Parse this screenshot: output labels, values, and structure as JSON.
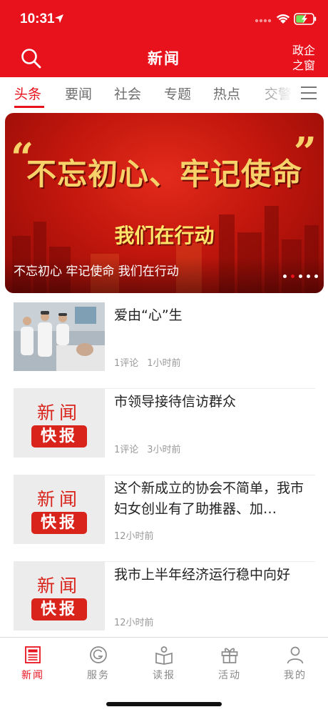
{
  "status_bar": {
    "time": "10:31"
  },
  "header": {
    "title": "新闻",
    "right_button": "政企之窗",
    "right_line1": "政企",
    "right_line2": "之窗"
  },
  "tabs": [
    "头条",
    "要闻",
    "社会",
    "专题",
    "热点",
    "交警"
  ],
  "active_tab": "头条",
  "banner": {
    "slogan_main": "不忘初心、牢记使命",
    "slogan_sub": "我们在行动",
    "caption": "不忘初心 牢记使命 我们在行动",
    "slides": 5,
    "active_slide": 2
  },
  "news": [
    {
      "title": "爱由“心”生",
      "comments": "1评论",
      "time": "1小时前",
      "thumb": "photo-nurses"
    },
    {
      "title": "市领导接待信访群众",
      "comments": "1评论",
      "time": "3小时前",
      "thumb": "news-flash"
    },
    {
      "title": "这个新成立的协会不简单，我市妇女创业有了助推器、加…",
      "comments": "",
      "time": "12小时前",
      "thumb": "news-flash"
    },
    {
      "title": "我市上半年经济运行稳中向好",
      "comments": "",
      "time": "12小时前",
      "thumb": "news-flash"
    }
  ],
  "thumb_text": {
    "top": "新闻",
    "bottom": "快报"
  },
  "tabbar": [
    {
      "label": "新闻",
      "icon": "newspaper-icon",
      "active": true
    },
    {
      "label": "服务",
      "icon": "service-icon",
      "active": false
    },
    {
      "label": "读报",
      "icon": "read-paper-icon",
      "active": false
    },
    {
      "label": "活动",
      "icon": "gift-icon",
      "active": false
    },
    {
      "label": "我的",
      "icon": "user-icon",
      "active": false
    }
  ],
  "colors": {
    "brand_red": "#e8121d",
    "inactive_gray": "#888888",
    "meta_gray": "#999999"
  }
}
